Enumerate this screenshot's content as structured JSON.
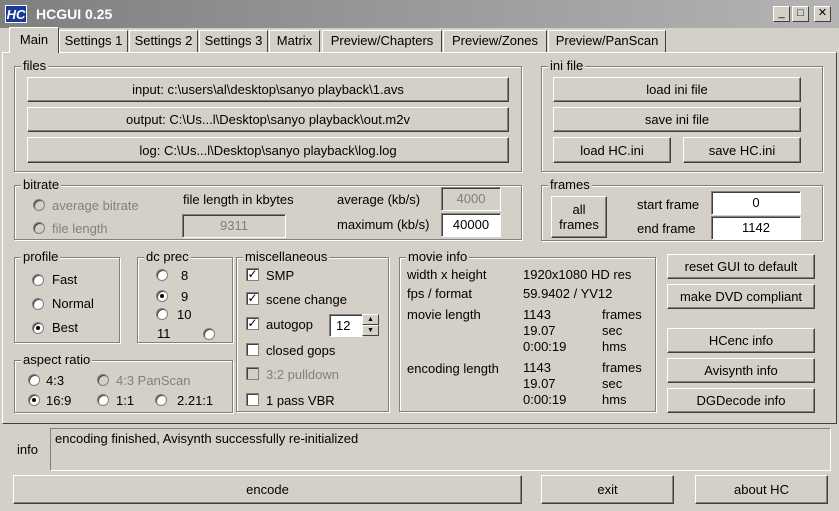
{
  "window": {
    "logo": "HC",
    "title": "HCGUI 0.25",
    "minimize": "_",
    "maximize": "□",
    "close": "✕"
  },
  "tabs": [
    {
      "label": "Main"
    },
    {
      "label": "Settings 1"
    },
    {
      "label": "Settings 2"
    },
    {
      "label": "Settings 3"
    },
    {
      "label": "Matrix"
    },
    {
      "label": "Preview/Chapters"
    },
    {
      "label": "Preview/Zones"
    },
    {
      "label": "Preview/PanScan"
    }
  ],
  "files": {
    "label": "files",
    "input": "input: c:\\users\\al\\desktop\\sanyo playback\\1.avs",
    "output": "output: C:\\Us...l\\Desktop\\sanyo playback\\out.m2v",
    "log": "log: C:\\Us...l\\Desktop\\sanyo playback\\log.log"
  },
  "ini_file": {
    "label": "ini file",
    "load": "load ini file",
    "save": "save ini file",
    "load_hc": "load HC.ini",
    "save_hc": "save HC.ini"
  },
  "bitrate": {
    "label": "bitrate",
    "average_bitrate": "average bitrate",
    "file_length": "file length",
    "file_length_kbytes_label": "file length in kbytes",
    "file_length_value": "9311",
    "average_label": "average (kb/s)",
    "average_value": "4000",
    "maximum_label": "maximum (kb/s)",
    "maximum_value": "40000"
  },
  "frames": {
    "label": "frames",
    "all_frames_line1": "all",
    "all_frames_line2": "frames",
    "start_label": "start frame",
    "start_value": "0",
    "end_label": "end frame",
    "end_value": "1142"
  },
  "profile": {
    "label": "profile",
    "options": [
      "Fast",
      "Normal",
      "Best"
    ],
    "selected": "Best"
  },
  "dc_prec": {
    "label": "dc prec",
    "options": [
      "8",
      "9",
      "10",
      "11"
    ],
    "selected": "9"
  },
  "misc": {
    "label": "miscellaneous",
    "smp": "SMP",
    "scene_change": "scene change",
    "autogop": "autogop",
    "autogop_value": "12",
    "closed_gops": "closed gops",
    "pulldown": "3:2 pulldown",
    "one_pass_vbr": "1 pass VBR"
  },
  "movie_info": {
    "label": "movie info",
    "width_height_label": "width x height",
    "width_height_value": "1920x1080 HD res",
    "fps_label": "fps / format",
    "fps_value": "59.9402 / YV12",
    "movie_length_label": "movie length",
    "movie_length": [
      "1143",
      "19.07",
      "0:00:19"
    ],
    "encoding_length_label": "encoding length",
    "encoding_length": [
      "1143",
      "19.07",
      "0:00:19"
    ],
    "units": [
      "frames",
      "sec",
      "hms"
    ]
  },
  "right_buttons": {
    "reset": "reset GUI to default",
    "dvd": "make DVD compliant",
    "hcenc": "HCenc info",
    "avisynth": "Avisynth info",
    "dgdecode": "DGDecode info"
  },
  "aspect_ratio": {
    "label": "aspect ratio",
    "r43": "4:3",
    "r43ps": "4:3 PanScan",
    "r169": "16:9",
    "r11": "1:1",
    "r2211": "2.21:1",
    "selected": "16:9"
  },
  "info": {
    "label": "info",
    "message": "encoding finished, Avisynth successfully re-initialized"
  },
  "bottom": {
    "encode": "encode",
    "exit": "exit",
    "about": "about HC"
  }
}
